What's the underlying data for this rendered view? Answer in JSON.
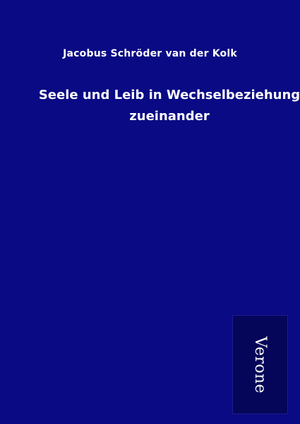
{
  "cover": {
    "background_color": "#0a0a84",
    "author": "Jacobus Schröder van der Kolk",
    "title_line1": "Seele und Leib in Wechselbeziehung",
    "title_line2": "zueinander",
    "publisher_logo_text": "Verone",
    "publisher_box_color": "#050559"
  }
}
